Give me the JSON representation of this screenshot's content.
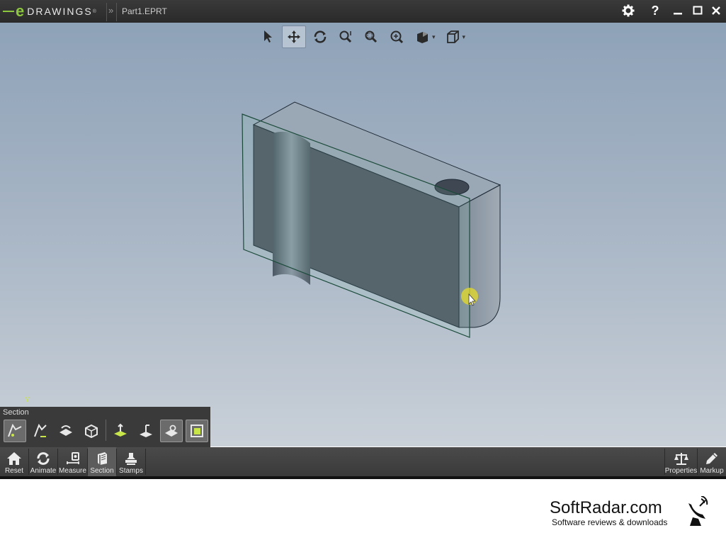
{
  "app": {
    "logo_letter": "e",
    "logo_word": "DRAWINGS",
    "logo_mark": "®",
    "document": "Part1.EPRT"
  },
  "window_buttons": [
    {
      "name": "settings",
      "icon": "gear-icon"
    },
    {
      "name": "help",
      "icon": "help-icon",
      "label": "?"
    },
    {
      "name": "minimize",
      "icon": "minimize-icon"
    },
    {
      "name": "maximize",
      "icon": "maximize-icon"
    },
    {
      "name": "close",
      "icon": "close-icon"
    }
  ],
  "view_toolbar": [
    {
      "name": "select",
      "icon": "pointer-icon"
    },
    {
      "name": "pan",
      "icon": "pan-icon",
      "active": true
    },
    {
      "name": "rotate",
      "icon": "rotate-icon"
    },
    {
      "name": "zoom",
      "icon": "zoom-icon"
    },
    {
      "name": "zoom-area",
      "icon": "zoom-area-icon"
    },
    {
      "name": "zoom-fit",
      "icon": "zoom-fit-icon"
    },
    {
      "name": "display-style",
      "icon": "display-style-icon",
      "dropdown": true
    },
    {
      "name": "view-orientation",
      "icon": "cube-icon",
      "dropdown": true
    }
  ],
  "axis_label": "Y",
  "section_panel": {
    "title": "Section",
    "tools": [
      "section-plane-x-icon",
      "section-plane-flip-icon",
      "section-plane-cap-icon",
      "section-box-icon",
      "section-plane-top-icon",
      "section-plane-align-icon",
      "section-show-plane-icon",
      "section-cap-fill-icon"
    ]
  },
  "bottom_toolbar": {
    "left": [
      {
        "label": "Reset",
        "icon": "home-icon"
      },
      {
        "label": "Animate",
        "icon": "animate-icon"
      },
      {
        "label": "Measure",
        "icon": "measure-icon"
      },
      {
        "label": "Section",
        "icon": "section-icon",
        "active": true
      },
      {
        "label": "Stamps",
        "icon": "stamp-icon"
      }
    ],
    "right": [
      {
        "label": "Properties",
        "icon": "scale-icon"
      },
      {
        "label": "Markup",
        "icon": "pencil-icon"
      }
    ]
  },
  "watermark": {
    "name": "SoftRadar.com",
    "tagline": "Software reviews & downloads"
  },
  "colors": {
    "accent_green": "#8dc63f",
    "titlebar": "#2e2e2e",
    "toolbar": "#404040",
    "viewport_top": "#8ea2b8",
    "viewport_bottom": "#c9d0d8"
  }
}
